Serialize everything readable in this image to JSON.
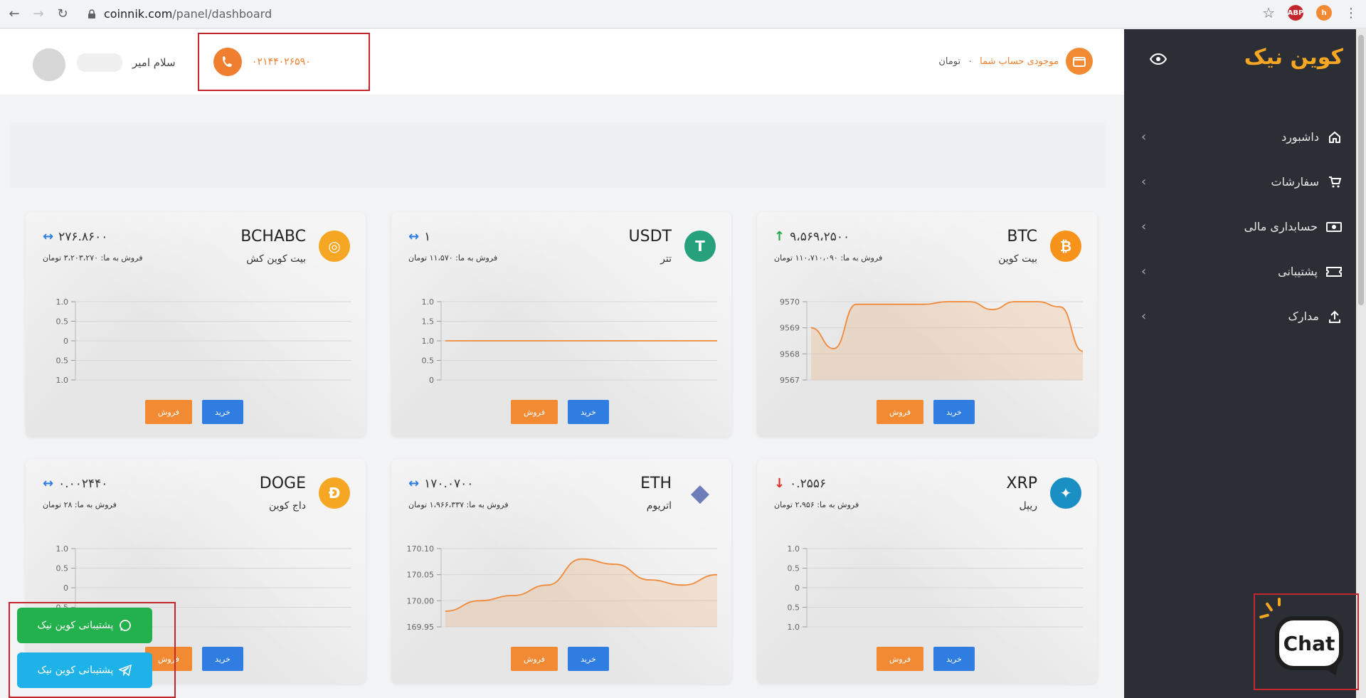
{
  "browser": {
    "url_host": "coinnik.com",
    "url_path": "/panel/dashboard",
    "ext1": "ABP",
    "ext2": "h"
  },
  "sidebar": {
    "logo": "کوین نیک",
    "items": [
      {
        "label": "داشبورد",
        "icon": "home-icon"
      },
      {
        "label": "سفارشات",
        "icon": "cart-icon"
      },
      {
        "label": "حسابداری مالی",
        "icon": "money-icon"
      },
      {
        "label": "پشتیبانی",
        "icon": "ticket-icon"
      },
      {
        "label": "مدارک",
        "icon": "upload-icon"
      }
    ]
  },
  "header": {
    "greeting": "سلام امیر",
    "phone": "۰۲۱۴۴۰۲۶۵۹۰",
    "balance_label": "موجودی حساب شما",
    "balance_sep": "۰",
    "balance_unit": "تومان"
  },
  "cards": [
    {
      "symbol": "BTC",
      "name_fa": "بیت کوین",
      "price": "۹،۵۶۹،۲۵۰۰",
      "trend": "up",
      "sell_rate": "فروش به ما: ۱۱۰،۷۱۰،۰۹۰ تومان",
      "icon": "bitcoin-icon",
      "color": "#f7931a",
      "buy": "خرید",
      "sell": "فروش"
    },
    {
      "symbol": "USDT",
      "name_fa": "تتر",
      "price": "۱",
      "trend": "flat",
      "sell_rate": "فروش به ما: ۱۱،۵۷۰ تومان",
      "icon": "tether-icon",
      "color": "#26a17b",
      "buy": "خرید",
      "sell": "فروش"
    },
    {
      "symbol": "BCHABC",
      "name_fa": "بیت کوین کش",
      "price": "۲۷۶.۸۶۰۰",
      "trend": "flat",
      "sell_rate": "فروش به ما: ۳،۲۰۳،۲۷۰ تومان",
      "icon": "bitcoin-cash-icon",
      "color": "#f5a623",
      "buy": "خرید",
      "sell": "فروش"
    },
    {
      "symbol": "XRP",
      "name_fa": "ریپل",
      "price": "۰.۲۵۵۶",
      "trend": "down",
      "sell_rate": "فروش به ما: ۲،۹۵۶ تومان",
      "icon": "ripple-icon",
      "color": "#1a8fc4",
      "buy": "خرید",
      "sell": "فروش"
    },
    {
      "symbol": "ETH",
      "name_fa": "اتریوم",
      "price": "۱۷۰.۰۷۰۰",
      "trend": "flat",
      "sell_rate": "فروش به ما: ۱،۹۶۶،۳۳۷ تومان",
      "icon": "ethereum-icon",
      "color": "#6f7cba",
      "buy": "خرید",
      "sell": "فروش"
    },
    {
      "symbol": "DOGE",
      "name_fa": "داج کوین",
      "price": "۰.۰۰۲۴۴۰",
      "trend": "flat",
      "sell_rate": "فروش به ما: ۲۸ تومان",
      "icon": "dogecoin-icon",
      "color": "#f5a623",
      "buy": "خرید",
      "sell": "فروش"
    }
  ],
  "chart_data": [
    {
      "type": "area",
      "coin": "BTC",
      "yticks": [
        "9570",
        "9569",
        "9568",
        "9567"
      ],
      "ylim": [
        9567,
        9570
      ],
      "y": [
        9569.0,
        9568.2,
        9569.9,
        9569.9,
        9569.9,
        9569.9,
        9570.0,
        9570.0,
        9569.7,
        9570.0,
        9570.0,
        9569.8,
        9568.1
      ],
      "color": "#f08a3a"
    },
    {
      "type": "line",
      "coin": "USDT",
      "yticks": [
        "1.0",
        "1.5",
        "1.0",
        "0.5",
        "0"
      ],
      "y": [
        1,
        1
      ],
      "color": "#f08a3a"
    },
    {
      "type": "line",
      "coin": "BCHABC",
      "yticks": [
        "1.0",
        "0.5",
        "0",
        "0.5",
        "1.0"
      ],
      "y": [],
      "color": "#f08a3a"
    },
    {
      "type": "line",
      "coin": "XRP",
      "yticks": [
        "1.0",
        "0.5",
        "0",
        "0.5",
        "1.0"
      ],
      "y": [],
      "color": "#f08a3a"
    },
    {
      "type": "area",
      "coin": "ETH",
      "yticks": [
        "170.10",
        "170.05",
        "170.00",
        "169.95"
      ],
      "ylim": [
        169.95,
        170.1
      ],
      "y": [
        169.98,
        170.0,
        170.01,
        170.03,
        170.08,
        170.07,
        170.04,
        170.03,
        170.05
      ],
      "color": "#f08a3a"
    },
    {
      "type": "line",
      "coin": "DOGE",
      "yticks": [
        "1.0",
        "0.5",
        "0",
        "0.5",
        "1.0"
      ],
      "y": [],
      "color": "#f08a3a"
    }
  ],
  "support": {
    "whatsapp": "پشتیبانی کوین نیک",
    "telegram": "پشتیبانی کوین نیک"
  },
  "chat": {
    "label": "Chat"
  }
}
